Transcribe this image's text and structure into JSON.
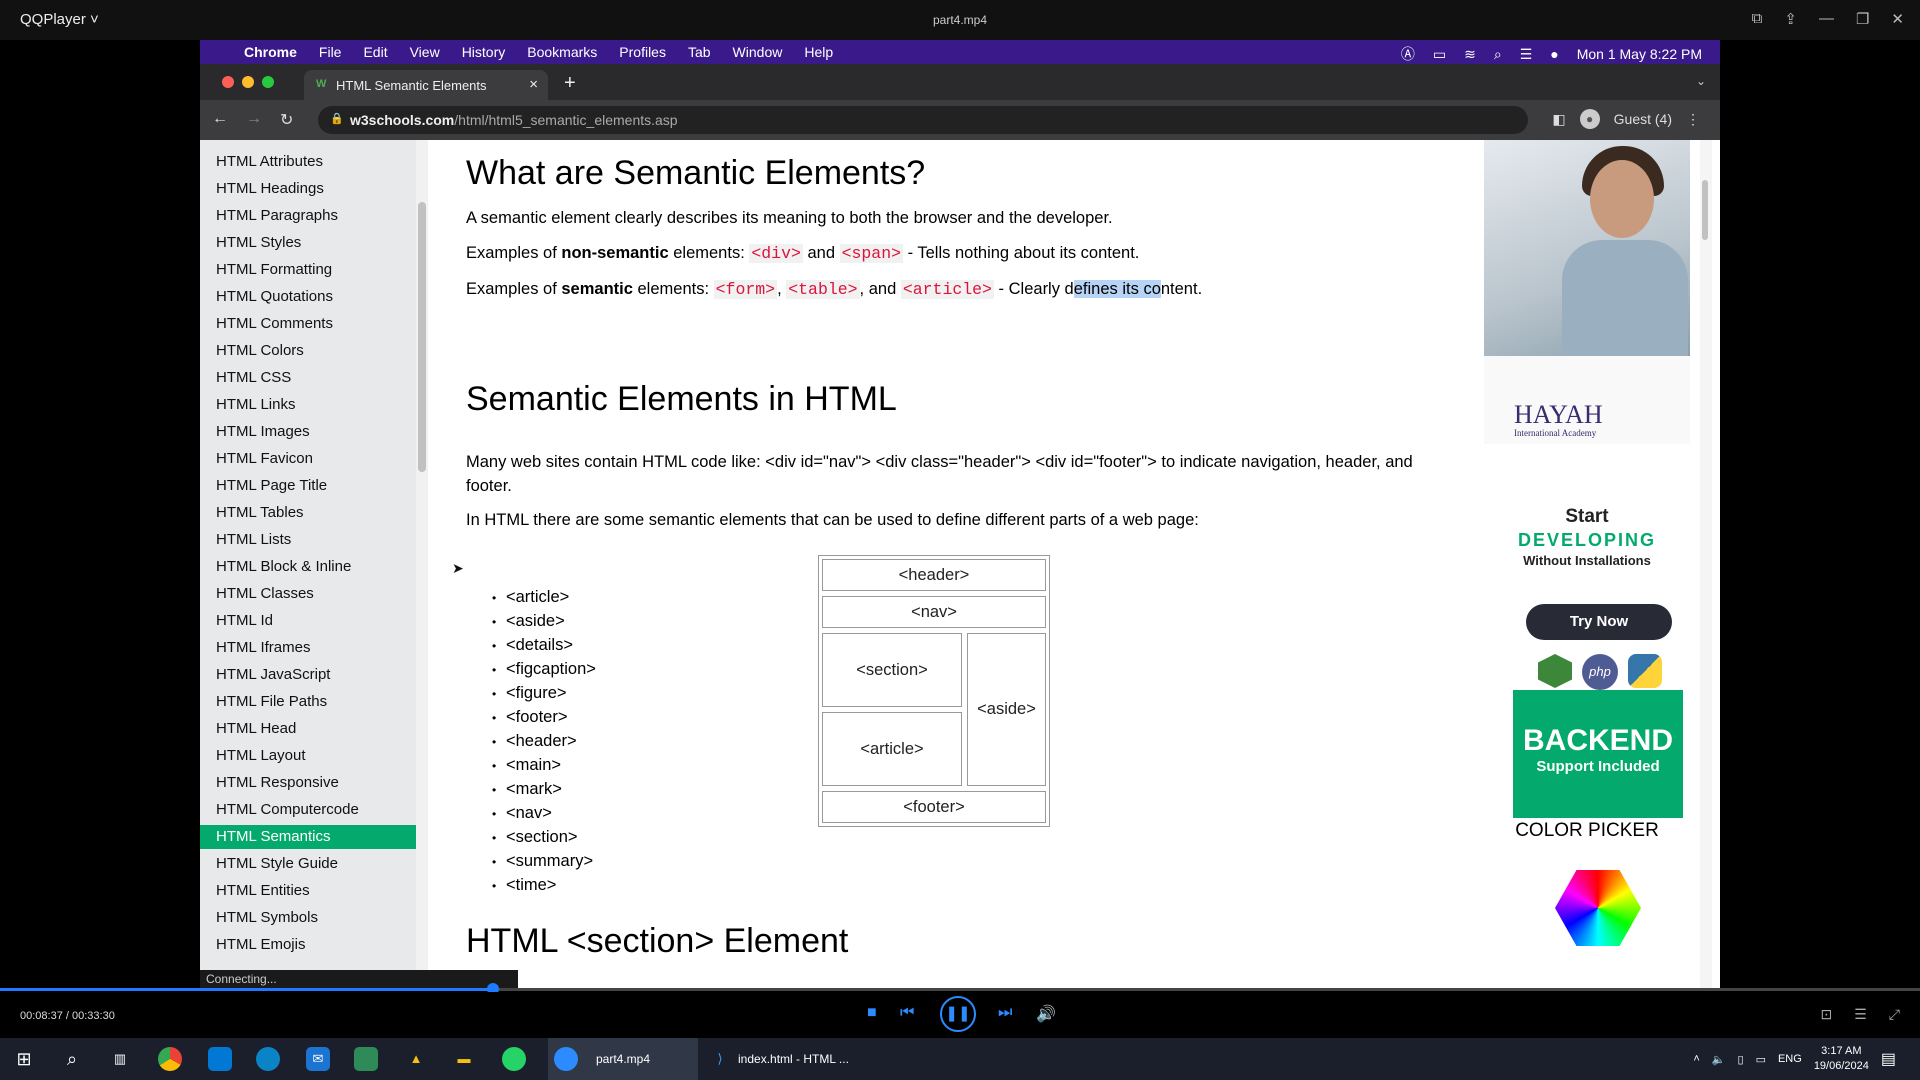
{
  "player": {
    "brand": "QQPlayer ˅",
    "title": "part4.mp4",
    "time": "00:08:37 / 00:33:30",
    "connecting": "Connecting...",
    "progress_fraction": 0.257
  },
  "mac": {
    "menu": [
      "Chrome",
      "File",
      "Edit",
      "View",
      "History",
      "Bookmarks",
      "Profiles",
      "Tab",
      "Window",
      "Help"
    ],
    "clock": "Mon 1 May  8:22 PM"
  },
  "chrome": {
    "tab_title": "HTML Semantic Elements",
    "url_host": "w3schools.com",
    "url_path": "/html/html5_semantic_elements.asp",
    "profile": "Guest (4)"
  },
  "sidebar": {
    "items": [
      "HTML Attributes",
      "HTML Headings",
      "HTML Paragraphs",
      "HTML Styles",
      "HTML Formatting",
      "HTML Quotations",
      "HTML Comments",
      "HTML Colors",
      "HTML CSS",
      "HTML Links",
      "HTML Images",
      "HTML Favicon",
      "HTML Page Title",
      "HTML Tables",
      "HTML Lists",
      "HTML Block & Inline",
      "HTML Classes",
      "HTML Id",
      "HTML Iframes",
      "HTML JavaScript",
      "HTML File Paths",
      "HTML Head",
      "HTML Layout",
      "HTML Responsive",
      "HTML Computercode",
      "HTML Semantics",
      "HTML Style Guide",
      "HTML Entities",
      "HTML Symbols",
      "HTML Emojis"
    ],
    "active": "HTML Semantics"
  },
  "main": {
    "h1": "What are Semantic Elements?",
    "p1": "A semantic element clearly describes its meaning to both the browser and the developer.",
    "p2_pre": "Examples of ",
    "p2_bold": "non-semantic",
    "p2_mid": " elements: ",
    "p2_c1": "<div>",
    "p2_and": " and ",
    "p2_c2": "<span>",
    "p2_end": " - Tells nothing about its content.",
    "p3_pre": "Examples of ",
    "p3_bold": "semantic",
    "p3_mid": " elements: ",
    "p3_c1": "<form>",
    "p3_comma": ", ",
    "p3_c2": "<table>",
    "p3_and": ", and ",
    "p3_c3": "<article>",
    "p3_a": " - Clearly d",
    "p3_hl": "efines its co",
    "p3_b": "ntent.",
    "h2": "Semantic Elements in HTML",
    "p4": "Many web sites contain HTML code like: <div id=\"nav\"> <div class=\"header\"> <div id=\"footer\"> to indicate navigation, header, and footer.",
    "p5": "In HTML there are some semantic elements that can be used to define different parts of a web page:",
    "list": [
      "<article>",
      "<aside>",
      "<details>",
      "<figcaption>",
      "<figure>",
      "<footer>",
      "<header>",
      "<main>",
      "<mark>",
      "<nav>",
      "<section>",
      "<summary>",
      "<time>"
    ],
    "diagram": {
      "header": "<header>",
      "nav": "<nav>",
      "section": "<section>",
      "article": "<article>",
      "aside": "<aside>",
      "footer": "<footer>"
    },
    "h3": "HTML <section> Element"
  },
  "ads": {
    "logo": "HAYAH",
    "logo_sub": "International Academy",
    "start": "Start",
    "developing": "DEVELOPING",
    "without": "Without Installations",
    "try": "Try Now",
    "backend": "BACKEND",
    "support": "Support Included",
    "color_picker": "COLOR PICKER"
  },
  "taskbar": {
    "app1": "part4.mp4",
    "app2": "index.html - HTML ...",
    "lang": "ENG",
    "time": "3:17 AM",
    "date": "19/06/2024"
  },
  "colors": {
    "w3green": "#04aa6d",
    "mac_menu": "#3a1a8a",
    "code_red": "#dc143c"
  }
}
